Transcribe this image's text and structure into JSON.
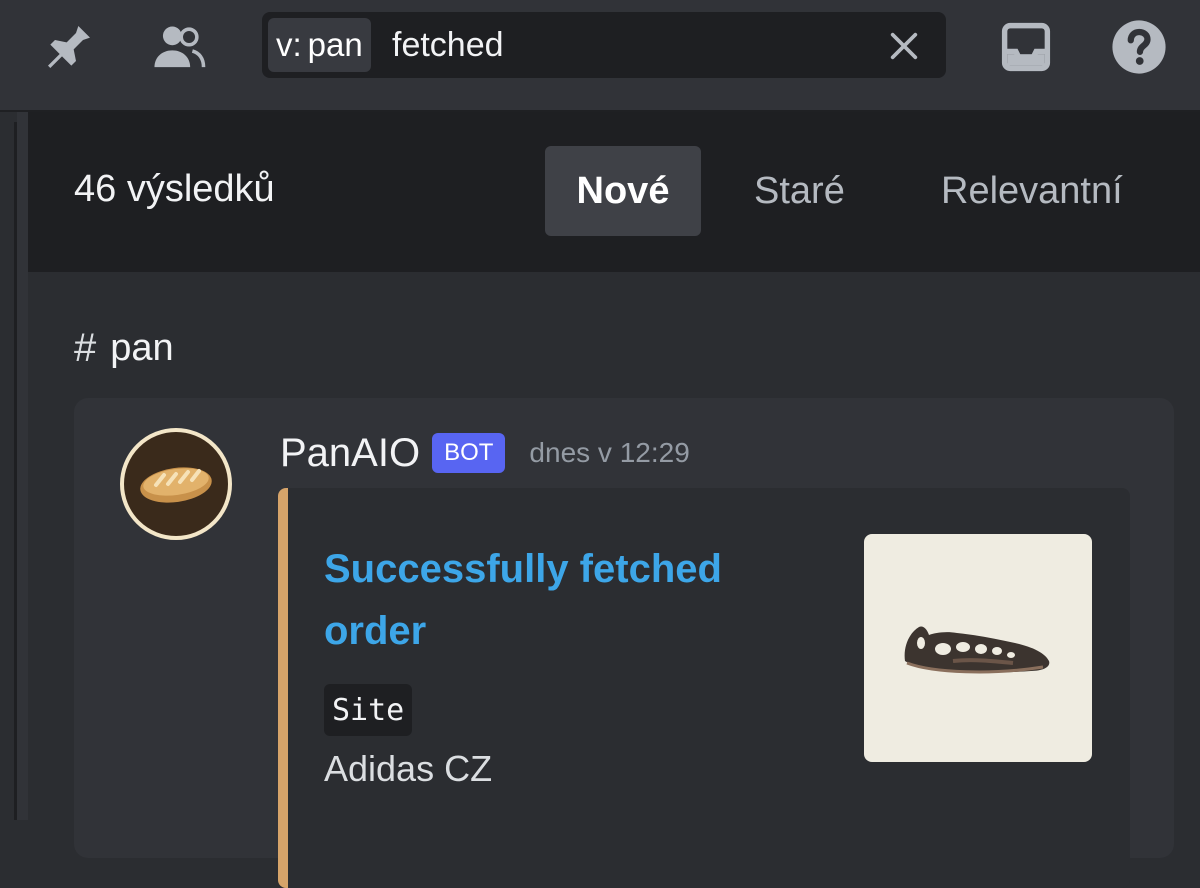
{
  "toolbar": {
    "icons": [
      "pin-icon",
      "members-icon",
      "inbox-icon",
      "help-icon"
    ]
  },
  "search": {
    "filter_key": "v:",
    "filter_value": "pan",
    "query": "fetched",
    "clear_icon": "close-icon"
  },
  "results": {
    "count_label": "46 výsledků",
    "sort_tabs": [
      {
        "label": "Nové",
        "selected": true
      },
      {
        "label": "Staré",
        "selected": false
      },
      {
        "label": "Relevantní",
        "selected": false
      }
    ]
  },
  "channel": {
    "hash": "#",
    "name": "pan"
  },
  "message": {
    "avatar": "bread-icon",
    "author": "PanAIO",
    "badge": "BOT",
    "timestamp": "dnes v 12:29",
    "embed": {
      "accent_color": "#d6a46a",
      "title": "Successfully fetched order",
      "fields": [
        {
          "name": "Site",
          "value": "Adidas CZ"
        }
      ],
      "thumbnail": "shoe-thumbnail"
    }
  },
  "colors": {
    "link_blue": "#3da6e8",
    "bot_badge": "#5865f2"
  }
}
